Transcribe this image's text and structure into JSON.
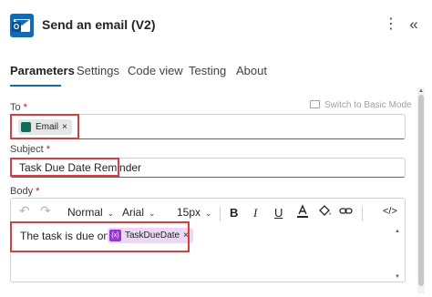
{
  "header": {
    "title": "Send an email (V2)",
    "app_icon": "outlook-icon",
    "menu_icon": "more-vertical-icon",
    "menu_glyph": "⋮",
    "collapse_icon": "double-chevron-left-icon",
    "collapse_glyph": "«"
  },
  "tabs": [
    {
      "label": "Parameters",
      "active": true
    },
    {
      "label": "Settings",
      "active": false
    },
    {
      "label": "Code view",
      "active": false
    },
    {
      "label": "Testing",
      "active": false
    },
    {
      "label": "About",
      "active": false
    }
  ],
  "form": {
    "required_mark": "*",
    "switch_basic_label": "Switch to Basic Mode",
    "to": {
      "label": "To",
      "token": {
        "label": "Email",
        "remove": "×"
      }
    },
    "subject": {
      "label": "Subject",
      "value": "Task Due Date Reminder"
    },
    "body": {
      "label": "Body",
      "toolbar": {
        "undo": "↶",
        "redo": "↷",
        "style": "Normal",
        "font": "Arial",
        "size": "15px",
        "bold": "B",
        "italic": "I",
        "underline": "U",
        "code_view": "</>"
      },
      "text": "The task is due on:",
      "token": {
        "label": "TaskDueDate",
        "icon_text": "{x}",
        "remove": "×"
      }
    }
  },
  "colors": {
    "accent": "#0f6cbd",
    "highlight": "#e03a3a",
    "variable_token": "#8c3bcf",
    "dynamic_token": "#0d6f5a"
  }
}
